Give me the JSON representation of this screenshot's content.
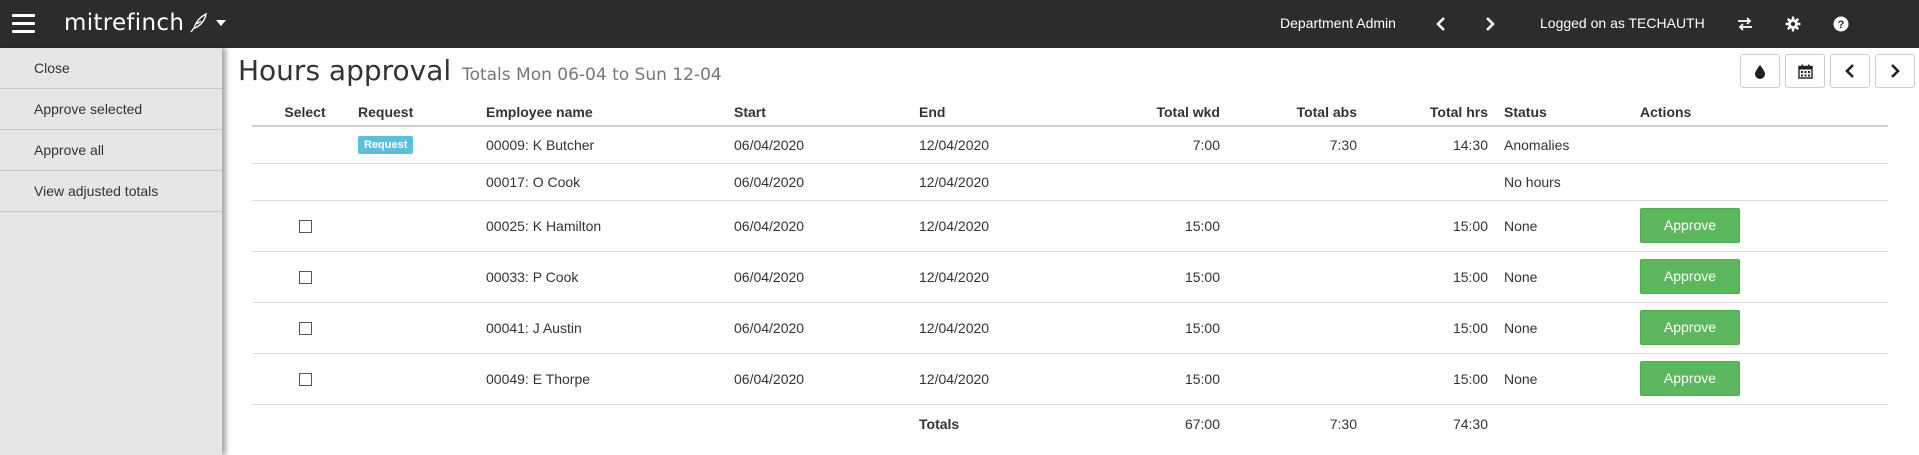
{
  "topbar": {
    "brand": "mitrefinch",
    "department": "Department Admin",
    "logged_on": "Logged on as TECHAUTH",
    "icons": [
      "menu-icon",
      "quill-icon",
      "caret-down-icon",
      "chevron-left-icon",
      "chevron-right-icon",
      "swap-icon",
      "gear-icon",
      "help-icon"
    ]
  },
  "sidebar": {
    "items": [
      {
        "label": "Close"
      },
      {
        "label": "Approve selected"
      },
      {
        "label": "Approve all"
      },
      {
        "label": "View adjusted totals"
      }
    ]
  },
  "page": {
    "title": "Hours approval",
    "subtitle": "Totals Mon 06-04 to Sun 12-04",
    "toolbar_icons": [
      "droplet-icon",
      "calendar-icon",
      "chevron-left-icon",
      "chevron-right-icon"
    ]
  },
  "table": {
    "headers": {
      "select": "Select",
      "request": "Request",
      "employee": "Employee name",
      "start": "Start",
      "end": "End",
      "total_wkd": "Total wkd",
      "total_abs": "Total abs",
      "total_hrs": "Total hrs",
      "status": "Status",
      "actions": "Actions"
    },
    "rows": [
      {
        "request_badge": "Request",
        "employee": "00009: K Butcher",
        "start": "06/04/2020",
        "end": "12/04/2020",
        "total_wkd": "7:00",
        "total_abs": "7:30",
        "total_hrs": "14:30",
        "status": "Anomalies"
      },
      {
        "employee": "00017: O Cook",
        "start": "06/04/2020",
        "end": "12/04/2020",
        "total_wkd": "",
        "total_abs": "",
        "total_hrs": "",
        "status": "No hours"
      },
      {
        "employee": "00025: K Hamilton",
        "start": "06/04/2020",
        "end": "12/04/2020",
        "total_wkd": "15:00",
        "total_abs": "",
        "total_hrs": "15:00",
        "status": "None",
        "action": "Approve"
      },
      {
        "employee": "00033: P Cook",
        "start": "06/04/2020",
        "end": "12/04/2020",
        "total_wkd": "15:00",
        "total_abs": "",
        "total_hrs": "15:00",
        "status": "None",
        "action": "Approve"
      },
      {
        "employee": "00041: J Austin",
        "start": "06/04/2020",
        "end": "12/04/2020",
        "total_wkd": "15:00",
        "total_abs": "",
        "total_hrs": "15:00",
        "status": "None",
        "action": "Approve"
      },
      {
        "employee": "00049: E Thorpe",
        "start": "06/04/2020",
        "end": "12/04/2020",
        "total_wkd": "15:00",
        "total_abs": "",
        "total_hrs": "15:00",
        "status": "None",
        "action": "Approve"
      }
    ],
    "totals": {
      "label": "Totals",
      "total_wkd": "67:00",
      "total_abs": "7:30",
      "total_hrs": "74:30"
    }
  },
  "colors": {
    "topbar_bg": "#2d2c2b",
    "sidebar_bg": "#e6e6e6",
    "approve_green": "#5cb85c",
    "request_badge": "#5bc0de"
  }
}
